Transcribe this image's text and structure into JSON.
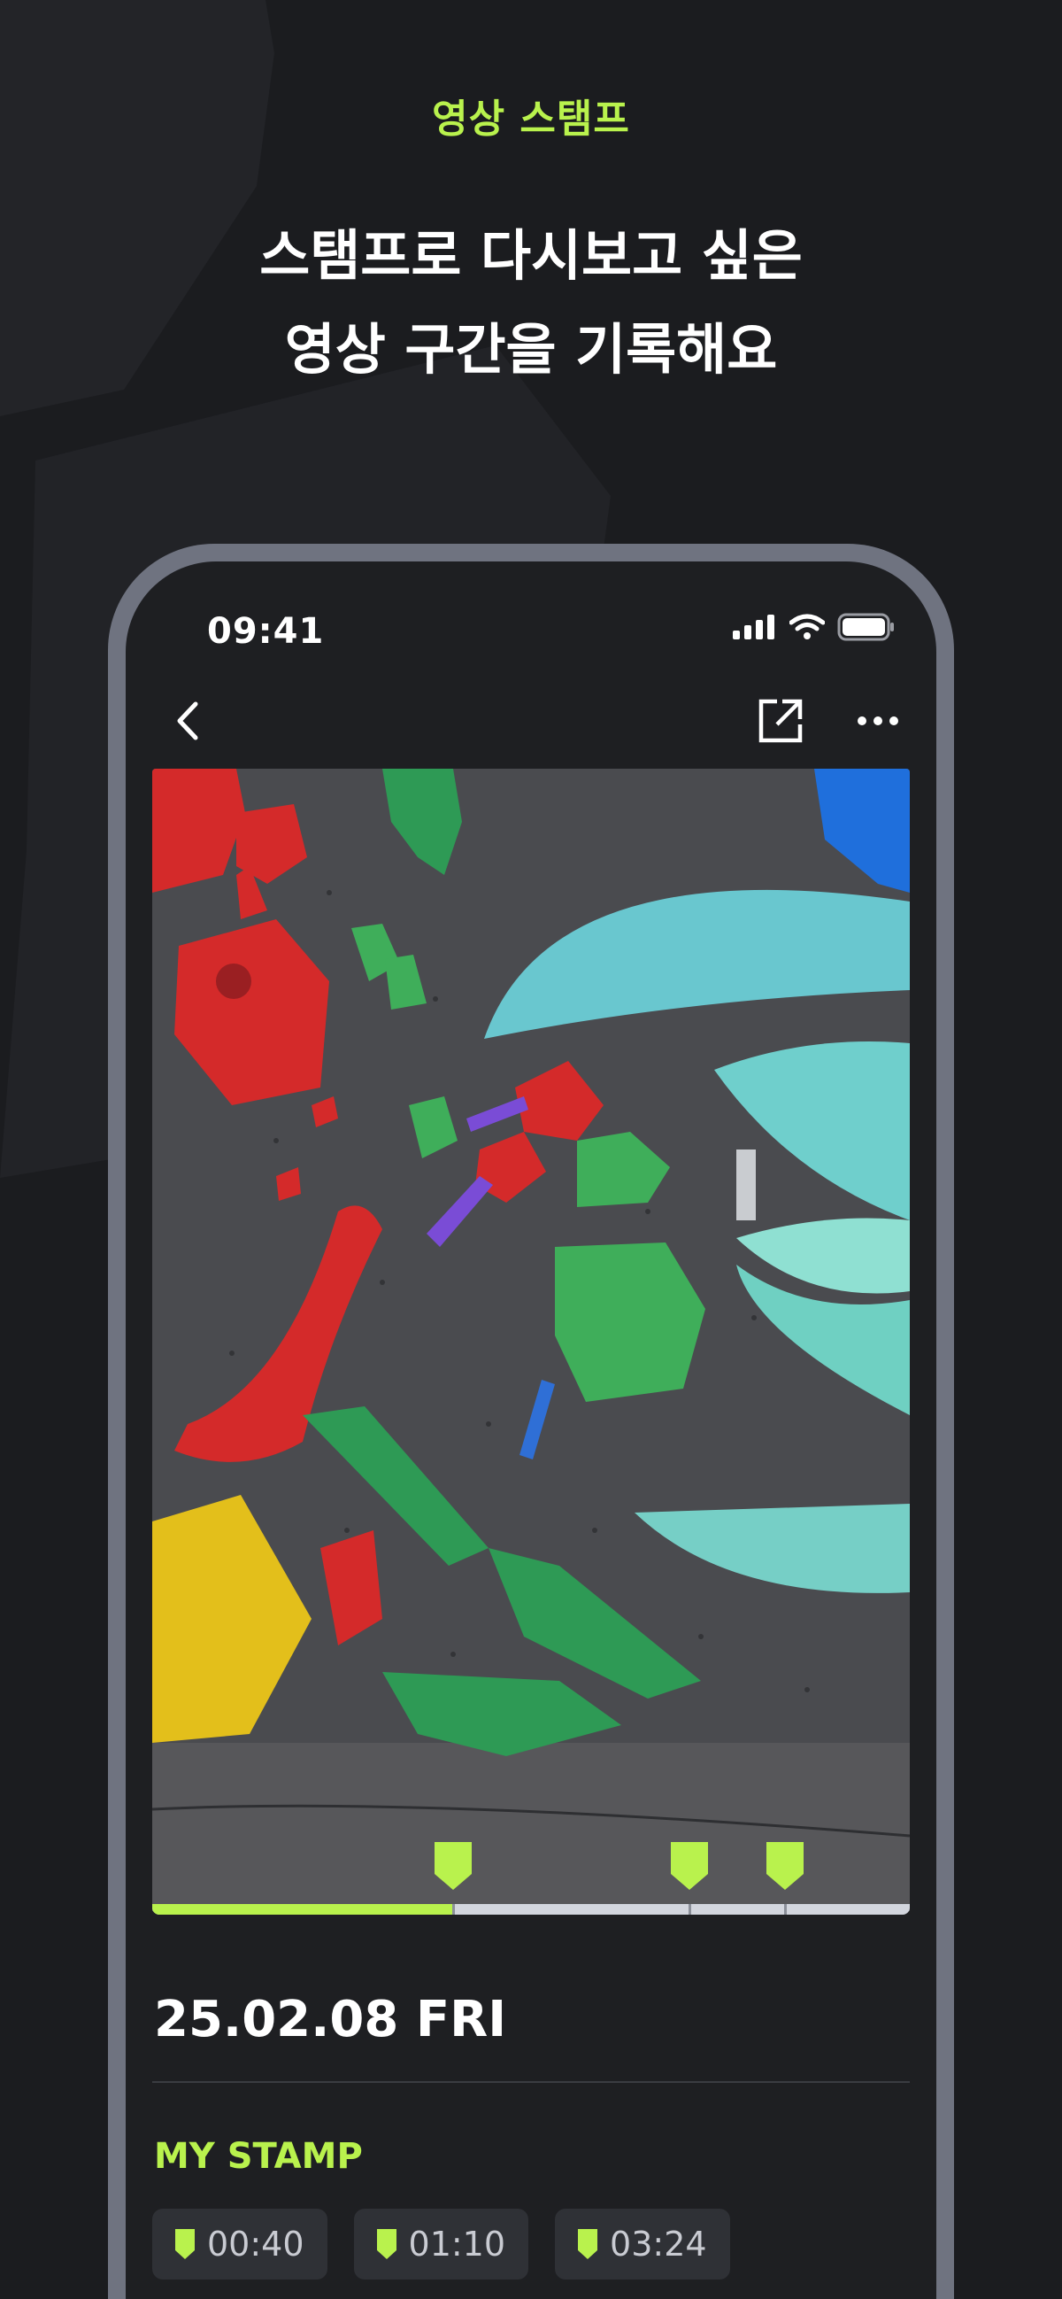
{
  "promo": {
    "eyebrow": "영상 스탬프",
    "headline_line1": "스탬프로 다시보고 싶은",
    "headline_line2": "영상 구간을 기록해요"
  },
  "status_bar": {
    "time": "09:41"
  },
  "nav": {
    "back_icon": "chevron-left-icon",
    "share_icon": "external-share-icon",
    "more_icon": "ellipsis-icon"
  },
  "video": {
    "progress": 0.4,
    "stamp_positions": [
      0.4,
      0.71,
      0.835
    ]
  },
  "detail": {
    "date": "25.02.08 FRI",
    "section_title": "MY STAMP",
    "stamps": [
      {
        "time": "00:40"
      },
      {
        "time": "01:10"
      },
      {
        "time": "03:24"
      }
    ]
  },
  "colors": {
    "accent": "#b9f24d",
    "background": "#1b1c1f",
    "chip_bg": "#2f3136"
  }
}
